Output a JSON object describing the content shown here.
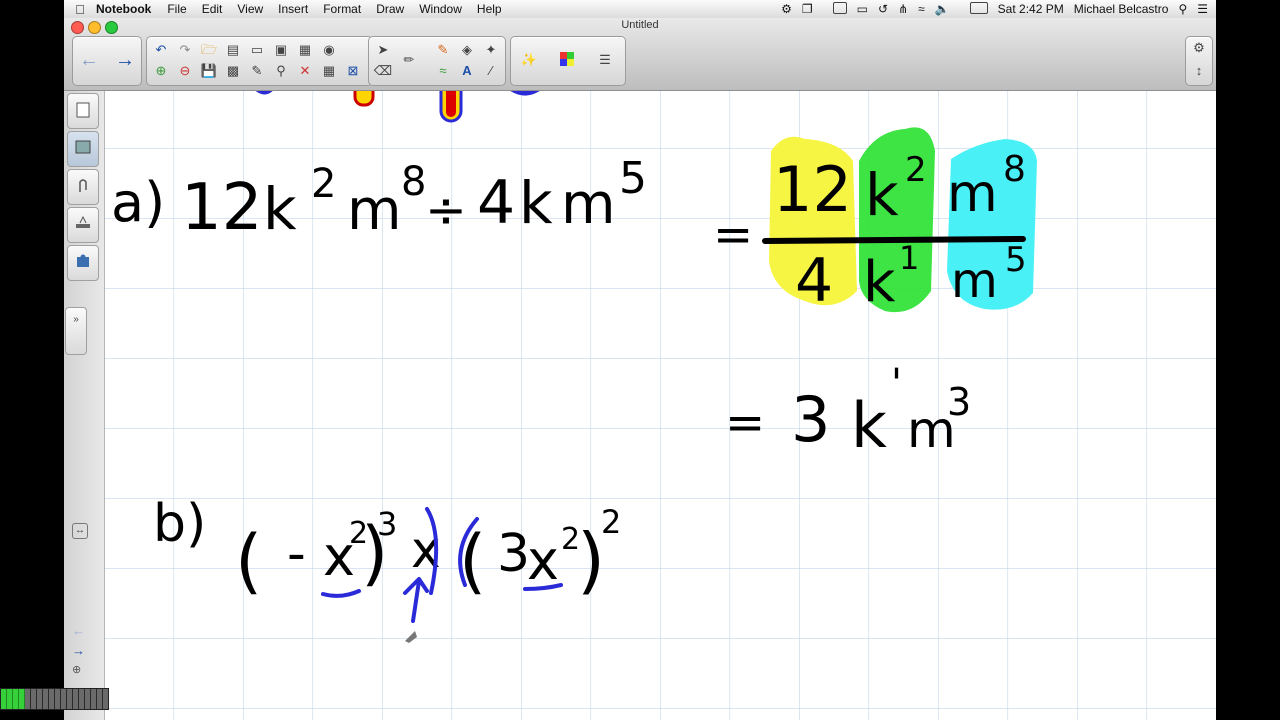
{
  "menubar": {
    "app_name": "Notebook",
    "items": [
      "File",
      "Edit",
      "View",
      "Insert",
      "Format",
      "Draw",
      "Window",
      "Help"
    ],
    "clock": "Sat 2:42 PM",
    "user": "Michael Belcastro"
  },
  "window": {
    "title": "Untitled"
  },
  "toolbar": {
    "icons": [
      "back-icon",
      "forward-icon",
      "undo-icon",
      "redo-icon",
      "open-icon",
      "insert-page-icon",
      "screen-shade-icon",
      "capture-icon",
      "table-icon",
      "spell-check-icon",
      "select-icon",
      "pen-icon",
      "fill-icon",
      "magic-pen-icon",
      "eraser-icon",
      "line-icon",
      "text-icon",
      "color-palette-icon",
      "properties-icon",
      "settings-icon",
      "expand-icon"
    ]
  },
  "canvas": {
    "problem_a": {
      "label": "a)",
      "coef1": "12",
      "var1": "k",
      "exp1": "2",
      "var2": "m",
      "exp2": "8",
      "div": "÷",
      "coef2": "4",
      "var3": "k",
      "var4": "m",
      "exp4": "5"
    },
    "fraction": {
      "eq": "=",
      "num_coef": "12",
      "num_k": "k",
      "num_k_exp": "2",
      "num_m": "m",
      "num_m_exp": "8",
      "den_coef": "4",
      "den_k": "k",
      "den_k_exp": "1",
      "den_m": "m",
      "den_m_exp": "5"
    },
    "result": {
      "eq": "=",
      "coef": "3",
      "k": "k",
      "k_exp": "'",
      "m": "m",
      "m_exp": "3"
    },
    "problem_b": {
      "label": "b)",
      "lp1": "(",
      "neg": "-",
      "x1": "x",
      "x1_exp": "2",
      "rp1": ")",
      "rp1_exp": "3",
      "x2": "x",
      "lp2": "(",
      "coef": "3",
      "x3": "x",
      "x3_exp": "2",
      "rp2": ")",
      "rp2_exp": "2"
    },
    "highlight_colors": {
      "yellow": "#f7f43a",
      "green": "#34e23a",
      "cyan": "#3ff0f5"
    }
  },
  "progress": {
    "level": 0.22
  }
}
